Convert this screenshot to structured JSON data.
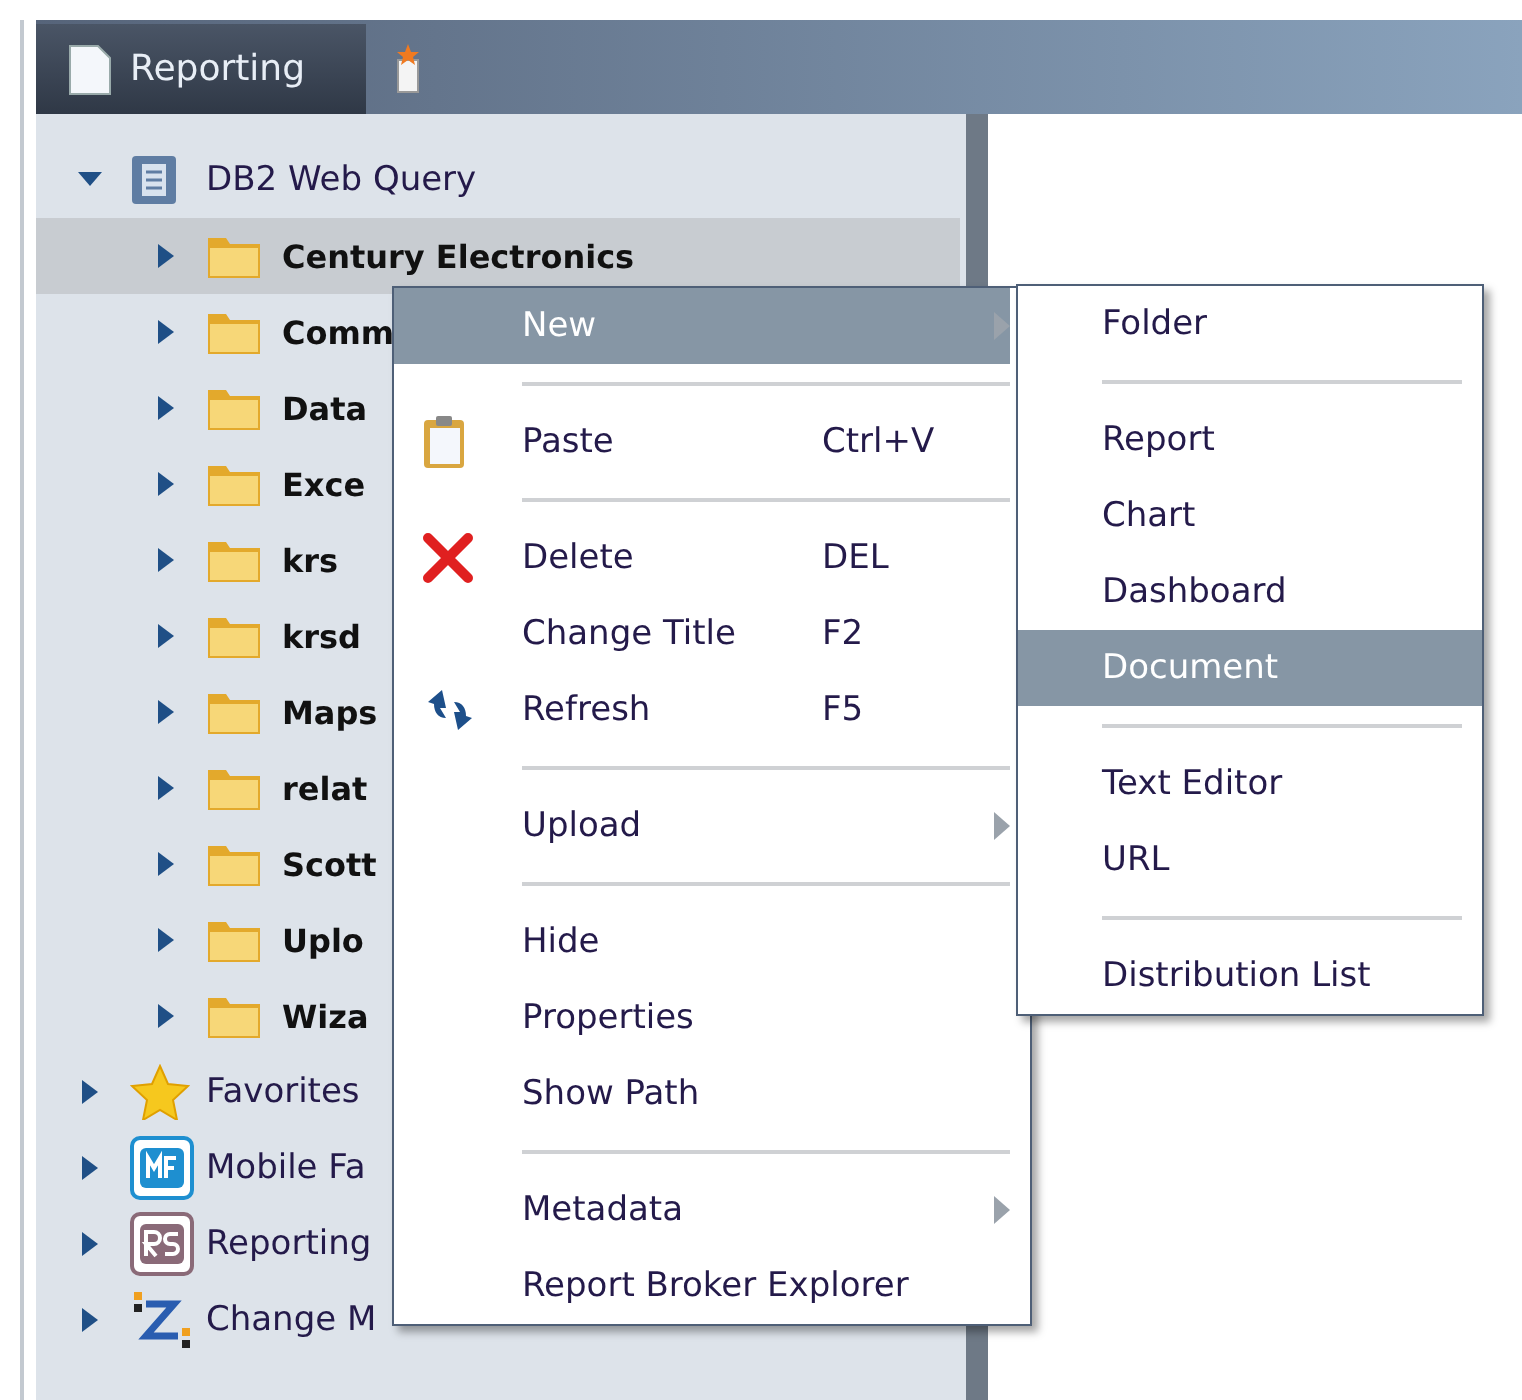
{
  "tabs": [
    {
      "label": "Reporting",
      "selected": true
    }
  ],
  "tree": [
    {
      "label": "DB2 Web Query",
      "kind": "database",
      "expanded": true,
      "selected": false,
      "children": [
        {
          "label": "Century Electronics",
          "kind": "folder",
          "expanded": false,
          "selected": true
        },
        {
          "label": "Comm",
          "kind": "folder",
          "expanded": false,
          "selected": false
        },
        {
          "label": "Data",
          "kind": "folder",
          "expanded": false,
          "selected": false
        },
        {
          "label": "Exce",
          "kind": "folder",
          "expanded": false,
          "selected": false
        },
        {
          "label": "krs",
          "kind": "folder",
          "expanded": false,
          "selected": false
        },
        {
          "label": "krsd",
          "kind": "folder",
          "expanded": false,
          "selected": false
        },
        {
          "label": "Maps",
          "kind": "folder",
          "expanded": false,
          "selected": false
        },
        {
          "label": "relat",
          "kind": "folder",
          "expanded": false,
          "selected": false
        },
        {
          "label": "Scott",
          "kind": "folder",
          "expanded": false,
          "selected": false
        },
        {
          "label": "Uplo",
          "kind": "folder",
          "expanded": false,
          "selected": false
        },
        {
          "label": "Wiza",
          "kind": "folder",
          "expanded": false,
          "selected": false
        }
      ]
    },
    {
      "label": "Favorites",
      "kind": "favorites",
      "expanded": false,
      "selected": false
    },
    {
      "label": "Mobile Fa",
      "kind": "mobile",
      "expanded": false,
      "selected": false
    },
    {
      "label": "Reporting",
      "kind": "rs",
      "expanded": false,
      "selected": false
    },
    {
      "label": "Change M",
      "kind": "change",
      "expanded": false,
      "selected": false
    }
  ],
  "context_menu": [
    {
      "kind": "item",
      "label": "New",
      "submenu": true,
      "selected": true
    },
    {
      "kind": "separator"
    },
    {
      "kind": "paste",
      "label": "Paste",
      "shortcut": "Ctrl+V",
      "selected": false
    },
    {
      "kind": "separator"
    },
    {
      "kind": "delete",
      "label": "Delete",
      "shortcut": "DEL",
      "selected": false
    },
    {
      "kind": "item",
      "label": "Change Title",
      "shortcut": "F2",
      "selected": false
    },
    {
      "kind": "refresh",
      "label": "Refresh",
      "shortcut": "F5",
      "selected": false
    },
    {
      "kind": "separator"
    },
    {
      "kind": "item",
      "label": "Upload",
      "submenu": true,
      "selected": false
    },
    {
      "kind": "separator"
    },
    {
      "kind": "item",
      "label": "Hide",
      "selected": false
    },
    {
      "kind": "item",
      "label": "Properties",
      "selected": false
    },
    {
      "kind": "item",
      "label": "Show Path",
      "selected": false
    },
    {
      "kind": "separator"
    },
    {
      "kind": "item",
      "label": "Metadata",
      "submenu": true,
      "selected": false
    },
    {
      "kind": "item",
      "label": "Report Broker Explorer",
      "selected": false
    }
  ],
  "submenu": [
    {
      "kind": "item",
      "label": "Folder",
      "selected": false
    },
    {
      "kind": "separator"
    },
    {
      "kind": "item",
      "label": "Report",
      "selected": false
    },
    {
      "kind": "item",
      "label": "Chart",
      "selected": false
    },
    {
      "kind": "item",
      "label": "Dashboard",
      "selected": false
    },
    {
      "kind": "item",
      "label": "Document",
      "selected": true
    },
    {
      "kind": "separator"
    },
    {
      "kind": "item",
      "label": "Text Editor",
      "selected": false
    },
    {
      "kind": "item",
      "label": "URL",
      "selected": false
    },
    {
      "kind": "separator"
    },
    {
      "kind": "item",
      "label": "Distribution List",
      "selected": false
    }
  ]
}
